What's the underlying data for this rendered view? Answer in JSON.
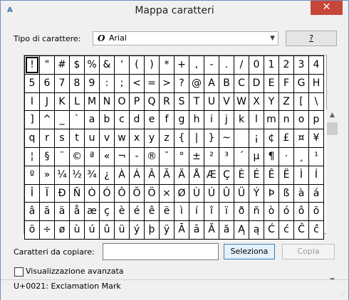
{
  "window": {
    "title": "Mappa caratteri",
    "close_glyph": "✕",
    "icon_text": "A"
  },
  "font": {
    "label": "Tipo di carattere:",
    "selected": "Arial",
    "symbol": "O",
    "help_label": "?"
  },
  "grid": {
    "selected_index": 0,
    "chars": [
      "!",
      "\"",
      "#",
      "$",
      "%",
      "&",
      "'",
      "(",
      ")",
      "*",
      "+",
      ",",
      "-",
      ".",
      "/",
      "0",
      "1",
      "2",
      "3",
      "4",
      "5",
      "6",
      "7",
      "8",
      "9",
      ":",
      ";",
      "<",
      "=",
      ">",
      "?",
      "@",
      "A",
      "B",
      "C",
      "D",
      "E",
      "F",
      "G",
      "H",
      "I",
      "J",
      "K",
      "L",
      "M",
      "N",
      "O",
      "P",
      "Q",
      "R",
      "S",
      "T",
      "U",
      "V",
      "W",
      "X",
      "Y",
      "Z",
      "[",
      "\\",
      "]",
      "^",
      "_",
      "`",
      "a",
      "b",
      "c",
      "d",
      "e",
      "f",
      "g",
      "h",
      "i",
      "j",
      "k",
      "l",
      "m",
      "n",
      "o",
      "p",
      "q",
      "r",
      "s",
      "t",
      "u",
      "v",
      "w",
      "x",
      "y",
      "z",
      "{",
      "|",
      "}",
      "~",
      " ",
      "¡",
      "¢",
      "£",
      "¤",
      "¥",
      "¦",
      "§",
      "¨",
      "©",
      "ª",
      "«",
      "¬",
      "-",
      "®",
      "¯",
      "°",
      "±",
      "²",
      "³",
      "´",
      "µ",
      "¶",
      "·",
      "¸",
      "¹",
      "º",
      "»",
      "¼",
      "½",
      "¾",
      "¿",
      "À",
      "Á",
      "Â",
      "Ã",
      "Ä",
      "Å",
      "Æ",
      "Ç",
      "È",
      "É",
      "Ê",
      "Ë",
      "Ì",
      "Í",
      "Î",
      "Ï",
      "Ð",
      "Ñ",
      "Ò",
      "Ó",
      "Ô",
      "Õ",
      "Ö",
      "×",
      "Ø",
      "Ù",
      "Ú",
      "Û",
      "Ü",
      "Ý",
      "Þ",
      "ß",
      "à",
      "á",
      "â",
      "ã",
      "ä",
      "å",
      "æ",
      "ç",
      "è",
      "é",
      "ê",
      "ë",
      "ì",
      "í",
      "î",
      "ï",
      "ð",
      "ñ",
      "ò",
      "ó",
      "ô",
      "õ",
      "ö",
      "÷",
      "ø",
      "ù",
      "ú",
      "û",
      "ü",
      "ý",
      "þ",
      "ÿ",
      "Ā",
      "ā",
      "Ă",
      "ă",
      "Ą",
      "ą",
      "Ć",
      "ć",
      "Ĉ",
      "ĉ"
    ]
  },
  "copy": {
    "label": "Caratteri da copiare:",
    "value": "",
    "select_label": "Seleziona",
    "copy_label": "Copia"
  },
  "advanced": {
    "label": "Visualizzazione avanzata",
    "checked": false
  },
  "status": {
    "text": "U+0021: Exclamation Mark"
  },
  "colors": {
    "close_button": "#c7463a",
    "select_border": "#3c7fb1"
  }
}
